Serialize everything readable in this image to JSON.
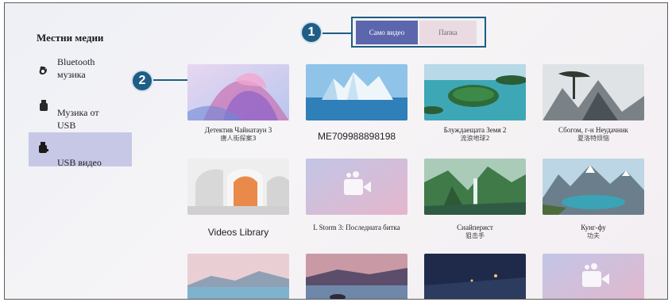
{
  "sidebar": {
    "title": "Местни медии",
    "items": [
      {
        "label_line1": "Bluetooth",
        "label_line2": "музика",
        "icon": "bluetooth-music-icon"
      },
      {
        "label_line1": "Музика от",
        "label_line2": "USB",
        "icon": "usb-music-icon"
      },
      {
        "label_line1": "USB видео",
        "label_line2": "",
        "icon": "usb-video-icon",
        "active": true
      }
    ]
  },
  "filter_tabs": {
    "items": [
      {
        "label": "Само видео",
        "selected": true
      },
      {
        "label": "Папка",
        "selected": false
      }
    ]
  },
  "callouts": [
    "1",
    "2"
  ],
  "grid": {
    "items": [
      {
        "title": "Детектив Чайнатаун 3",
        "subtitle": "唐人街探案3",
        "thumb": "flower"
      },
      {
        "title": "ME709988898198",
        "subtitle": "",
        "thumb": "glacier"
      },
      {
        "title": "Блуждаещата Земя 2",
        "subtitle": "流浪地球2",
        "thumb": "island"
      },
      {
        "title": "Сбогом, г-н Неудачник",
        "subtitle": "夏洛特烦恼",
        "thumb": "mountain-tree"
      },
      {
        "title": "Videos Library",
        "subtitle": "",
        "thumb": "arches"
      },
      {
        "title": "L Storm 3: Последната битка",
        "subtitle": "",
        "thumb": "video-placeholder"
      },
      {
        "title": "Снайперист",
        "subtitle": "狙击手",
        "thumb": "forest-falls"
      },
      {
        "title": "Кунг-фу",
        "subtitle": "功夫",
        "thumb": "alpine-lake"
      },
      {
        "title": "",
        "subtitle": "",
        "thumb": "lake-sunset"
      },
      {
        "title": "",
        "subtitle": "",
        "thumb": "dusk-rocks"
      },
      {
        "title": "",
        "subtitle": "",
        "thumb": "night-coast"
      },
      {
        "title": "",
        "subtitle": "",
        "thumb": "video-placeholder"
      }
    ]
  },
  "colors": {
    "accent": "#5c66ad",
    "sidebar_active": "#c6c8e6",
    "callout": "#1f5d86"
  }
}
